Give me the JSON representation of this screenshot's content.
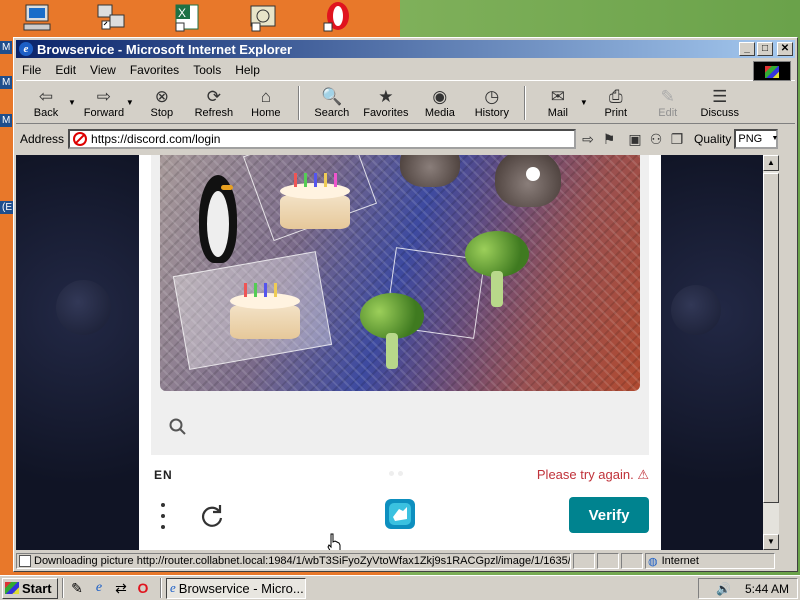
{
  "window": {
    "title": "Browservice - Microsoft Internet Explorer"
  },
  "menu": [
    "File",
    "Edit",
    "View",
    "Favorites",
    "Tools",
    "Help"
  ],
  "toolbar": {
    "back": "Back",
    "forward": "Forward",
    "stop": "Stop",
    "refresh": "Refresh",
    "home": "Home",
    "search": "Search",
    "favorites": "Favorites",
    "media": "Media",
    "history": "History",
    "mail": "Mail",
    "print": "Print",
    "edit": "Edit",
    "discuss": "Discuss"
  },
  "address": {
    "label": "Address",
    "url": "https://discord.com/login",
    "quality_label": "Quality",
    "quality_value": "PNG"
  },
  "captcha": {
    "language": "EN",
    "error": "Please try again. ⚠",
    "verify": "Verify"
  },
  "status": {
    "message": "Downloading picture http://router.collabnet.local:1984/1/wbT3SiFyoZyVtoWfax1Zkj9s1RACGpzl/image/1/1635/",
    "zone": "Internet"
  },
  "taskbar": {
    "start": "Start",
    "task": "Browservice - Micro...",
    "clock": "5:44 AM"
  },
  "desktop": {
    "label_fragment_1": "M",
    "label_fragment_2": "M",
    "label_fragment_3": "M",
    "label_fragment_4": "(E"
  },
  "colors": {
    "titlebar_start": "#0a246a",
    "verify": "#00838f",
    "error": "#c0323a"
  }
}
